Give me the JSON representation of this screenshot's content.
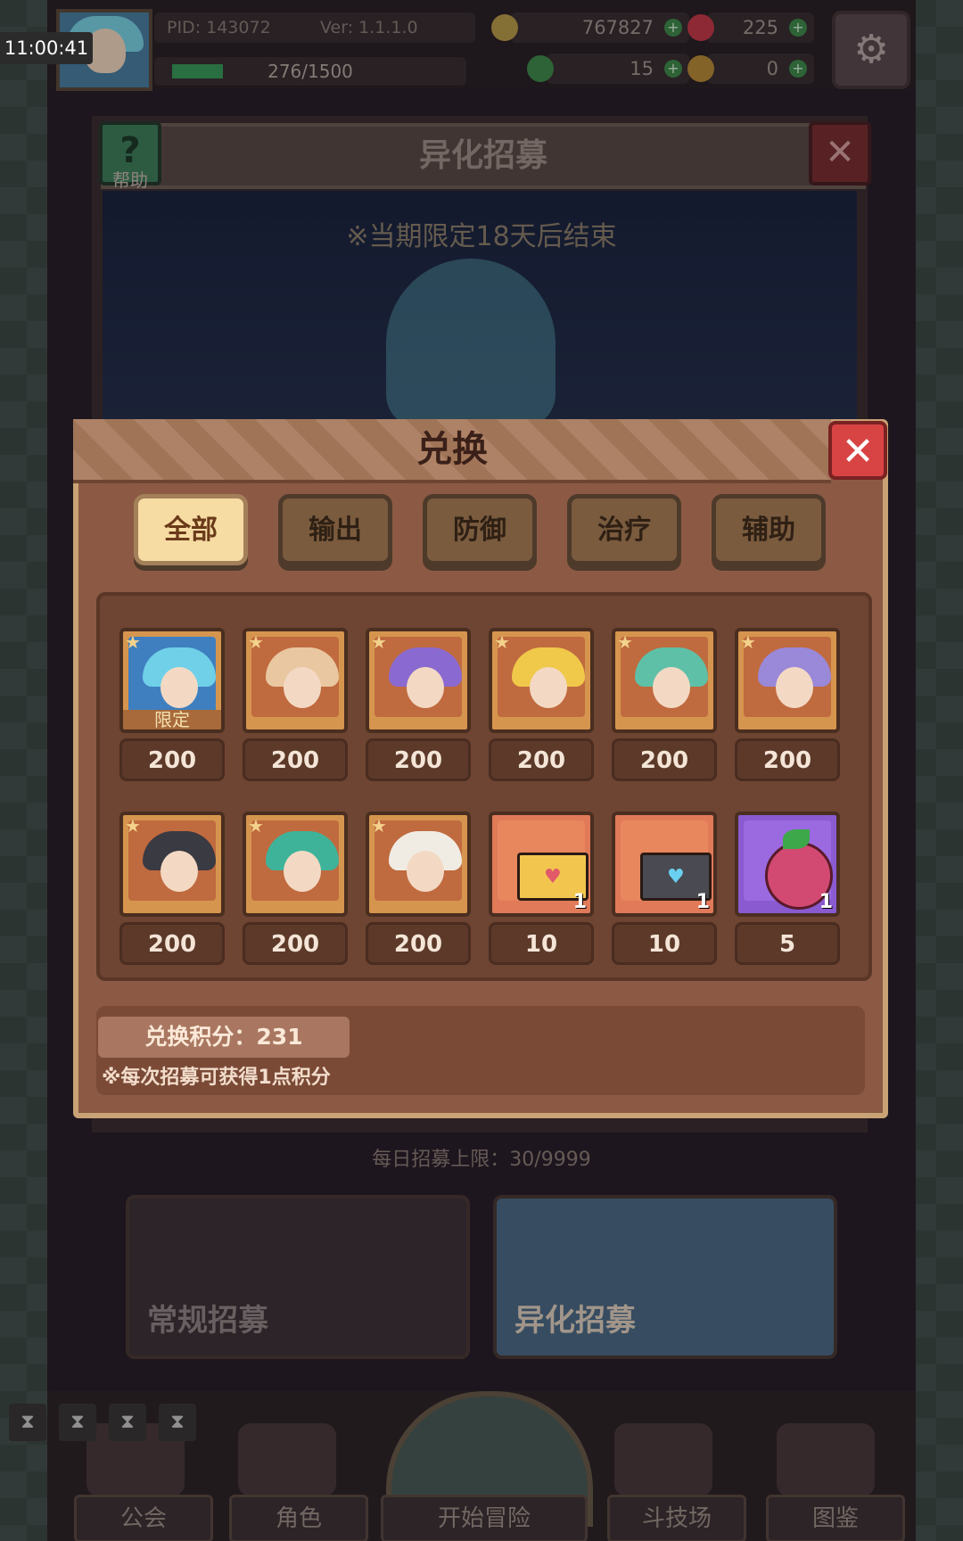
{
  "status": {
    "clock": "11:00:41"
  },
  "topbar": {
    "pid": "PID: 143072",
    "version": "Ver: 1.1.1.0",
    "exp": "276/1500",
    "exp_fraction": 0.184,
    "coins": "767827",
    "gems": "225",
    "clover": "15",
    "key": "0"
  },
  "background": {
    "help_label": "帮助",
    "title": "异化招募",
    "limited_notice": "※当期限定18天后结束",
    "daily_limit": "每日招募上限：30/9999",
    "recruit_normal": "常规招募",
    "recruit_special": "异化招募"
  },
  "nav": {
    "guild": "公会",
    "character": "角色",
    "start": "开始冒险",
    "arena": "斗技场",
    "codex": "图鉴"
  },
  "dialog": {
    "title": "兑换",
    "tabs": [
      {
        "label": "全部",
        "active": true
      },
      {
        "label": "输出",
        "active": false
      },
      {
        "label": "防御",
        "active": false
      },
      {
        "label": "治疗",
        "active": false
      },
      {
        "label": "辅助",
        "active": false
      }
    ],
    "limited_tag": "限定",
    "items": [
      {
        "type": "hero",
        "hair": "#6fd0e8",
        "bg": "#3f7fc0",
        "price": "200"
      },
      {
        "type": "hero",
        "hair": "#e9c7a0",
        "bg": "#c06a3f",
        "price": "200"
      },
      {
        "type": "hero",
        "hair": "#8a6ad0",
        "bg": "#c06a3f",
        "price": "200"
      },
      {
        "type": "hero",
        "hair": "#f0c84a",
        "bg": "#c06a3f",
        "price": "200"
      },
      {
        "type": "hero",
        "hair": "#5fc0a8",
        "bg": "#c06a3f",
        "price": "200"
      },
      {
        "type": "hero",
        "hair": "#9a88d8",
        "bg": "#c06a3f",
        "price": "200"
      },
      {
        "type": "hero",
        "hair": "#3a3a42",
        "bg": "#c06a3f",
        "price": "200"
      },
      {
        "type": "hero",
        "hair": "#3fb39a",
        "bg": "#c06a3f",
        "price": "200"
      },
      {
        "type": "hero",
        "hair": "#f0ece4",
        "bg": "#c06a3f",
        "price": "200"
      },
      {
        "type": "letter",
        "env": "#f2c64e",
        "count": "1",
        "price": "10"
      },
      {
        "type": "letter",
        "env": "#4a4a52",
        "count": "1",
        "price": "10"
      },
      {
        "type": "fruit",
        "count": "1",
        "price": "5"
      }
    ],
    "points": "兑换积分：231",
    "note": "※每次招募可获得1点积分"
  }
}
